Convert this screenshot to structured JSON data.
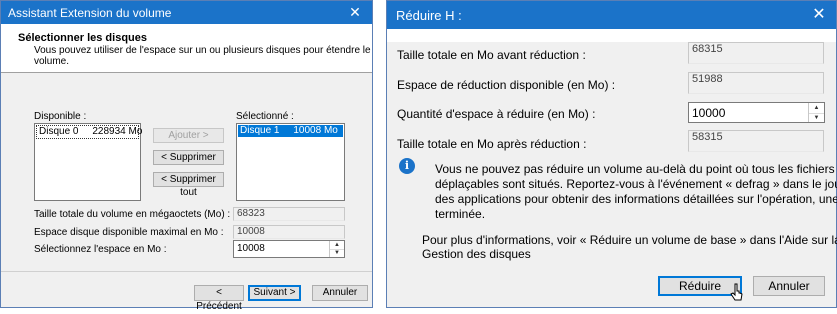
{
  "left_dialog": {
    "title": "Assistant Extension du volume",
    "header_title": "Sélectionner les disques",
    "header_desc_line1": "Vous pouvez utiliser de l'espace sur un ou plusieurs disques pour étendre le",
    "header_desc_line2": "volume.",
    "available_label": "Disponible :",
    "available_item": "Disque 0     228934 Mo",
    "selected_label": "Sélectionné :",
    "selected_item": "Disque 1     10008 Mo",
    "add_button": "Ajouter >",
    "remove_button": "< Supprimer",
    "remove_all_button": "< Supprimer tout",
    "total_size_label": "Taille totale du volume en mégaoctets (Mo) :",
    "total_size_value": "68323",
    "max_space_label": "Espace disque disponible maximal en Mo :",
    "max_space_value": "10008",
    "select_space_label": "Sélectionnez l'espace en Mo :",
    "select_space_value": "10008",
    "prev_button": "< Précédent",
    "next_button": "Suivant >",
    "cancel_button": "Annuler"
  },
  "right_dialog": {
    "title": "Réduire H :",
    "total_before_label": "Taille totale en Mo avant réduction :",
    "total_before_value": "68315",
    "available_shrink_label": "Espace de réduction disponible (en Mo) :",
    "available_shrink_value": "51988",
    "shrink_amount_label": "Quantité d'espace à réduire (en Mo) :",
    "shrink_amount_value": "10000",
    "total_after_label": "Taille totale en Mo après réduction :",
    "total_after_value": "58315",
    "info_line1": "Vous ne pouvez pas réduire un volume au-delà du point où tous les fichiers non",
    "info_line2": "déplaçables sont situés. Reportez-vous à l'événement « defrag » dans le journal",
    "info_line3": "des applications pour obtenir des informations détaillées sur l'opération, une fois",
    "info_line4": "terminée.",
    "help_line1": "Pour plus d'informations, voir « Réduire un volume de base » dans l'Aide sur la",
    "help_line2": "Gestion des disques",
    "shrink_button": "Réduire",
    "cancel_button": "Annuler"
  },
  "icons": [
    "close-icon",
    "info-icon",
    "spin-up-icon",
    "spin-down-icon",
    "mouse-cursor-icon"
  ],
  "colors": {
    "titlebar": "#1b73c9",
    "selection": "#0078d7",
    "info": "#1b73c9"
  }
}
